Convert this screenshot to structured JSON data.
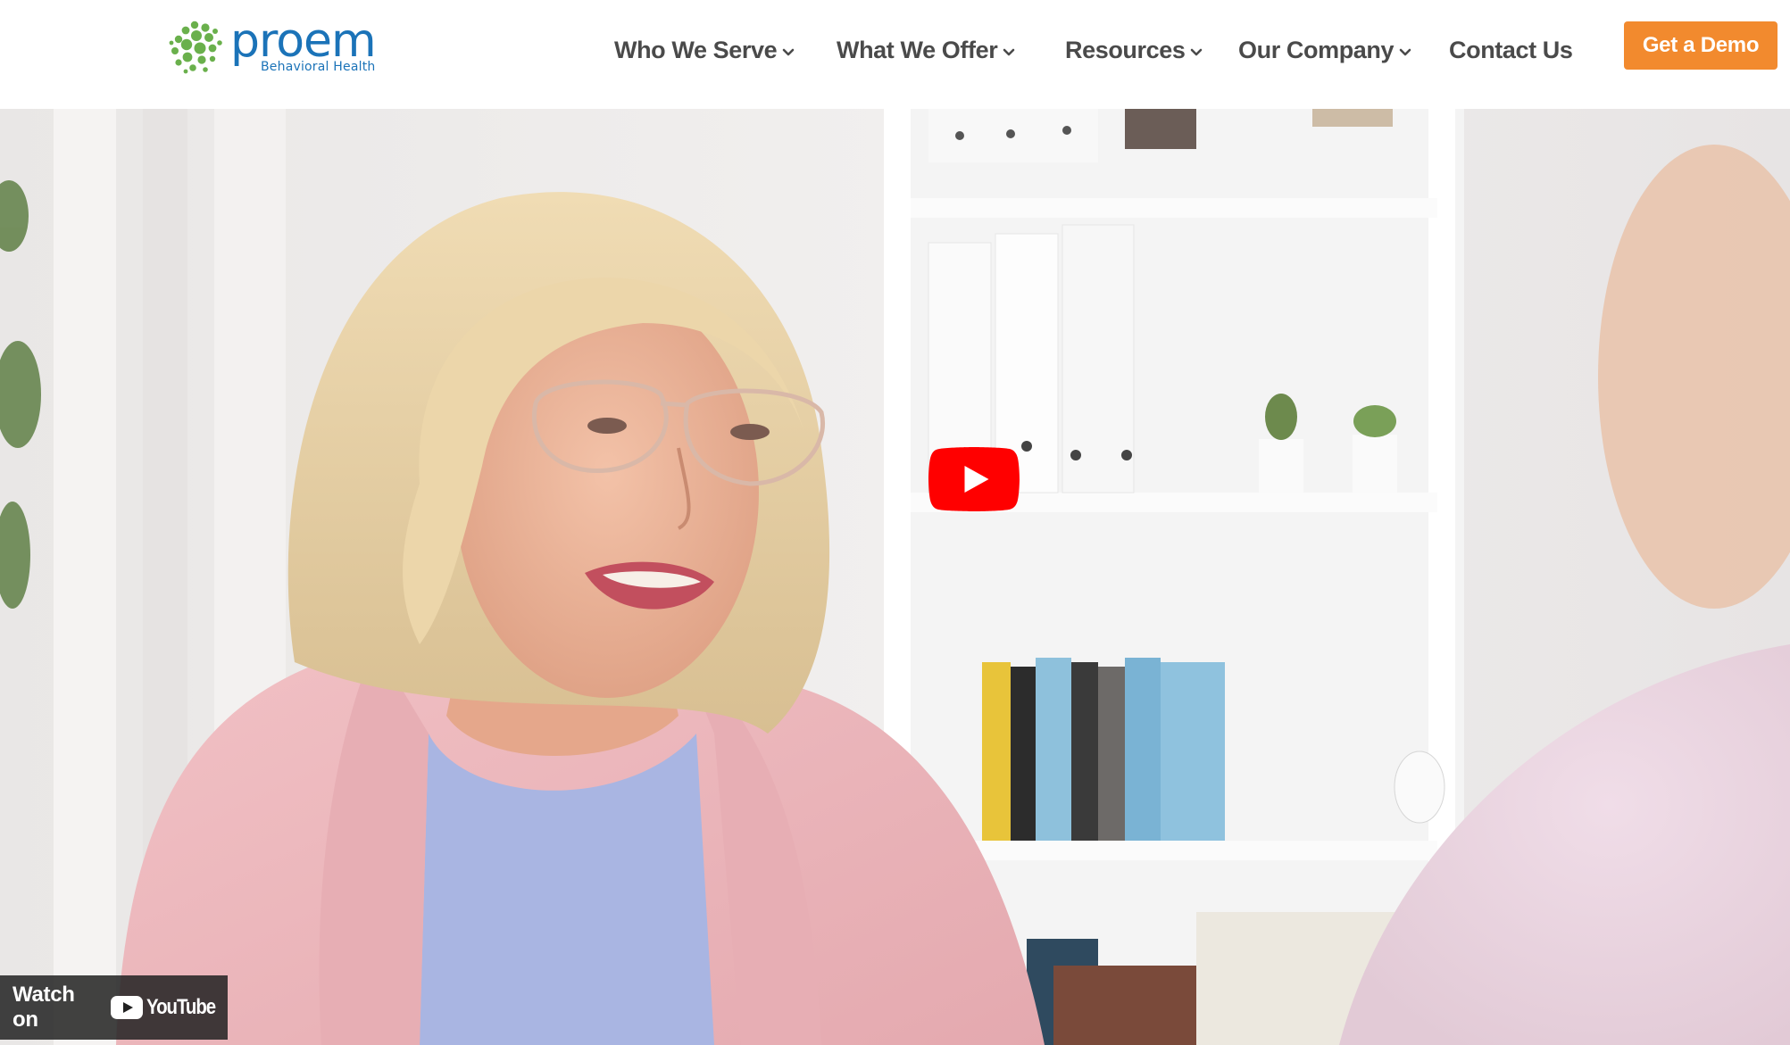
{
  "header": {
    "logo": {
      "name": "proem",
      "tagline": "Behavioral Health",
      "mark_icon": "cluster-dots-logo-icon",
      "brand_color": "#1b73b8",
      "mark_color": "#6ab04c"
    },
    "nav": [
      {
        "label": "Who We Serve",
        "has_dropdown": true,
        "icon": "chevron-down-icon"
      },
      {
        "label": "What We Offer",
        "has_dropdown": true,
        "icon": "chevron-down-icon"
      },
      {
        "label": "Resources",
        "has_dropdown": true,
        "icon": "chevron-down-icon"
      },
      {
        "label": "Our Company",
        "has_dropdown": true,
        "icon": "chevron-down-icon"
      },
      {
        "label": "Contact Us",
        "has_dropdown": false
      }
    ],
    "cta": {
      "label": "Get a Demo",
      "color": "#f28a2e"
    }
  },
  "video": {
    "play_icon": "youtube-play-icon",
    "play_color": "#ff0000",
    "watch_on_label": "Watch on",
    "platform_label": "YouTube",
    "platform_icon": "youtube-logo-icon"
  }
}
